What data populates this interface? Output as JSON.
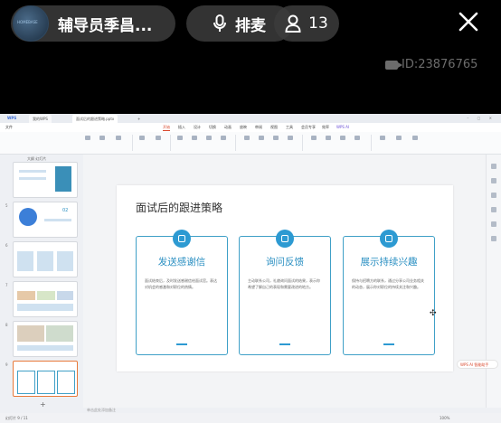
{
  "stream": {
    "host_name": "辅导员季昌...",
    "host_avatar_text": "HOMEBASE",
    "mic_label": "排麦",
    "viewer_count": "13",
    "stream_id": "ID:23876765",
    "icons": [
      "microphone-icon",
      "user-icon",
      "close-icon",
      "camera-icon"
    ]
  },
  "wps": {
    "app_logo": "WPS",
    "tabs": [
      "我的WPS",
      "面试后的跟进策略.pptx",
      "+"
    ],
    "menu": [
      "文件",
      "开始",
      "插入",
      "设计",
      "切换",
      "动画",
      "放映",
      "审阅",
      "视图",
      "工具",
      "会员专享",
      "效率",
      "WPS AI"
    ],
    "active_menu": "开始",
    "thumb_header": "大纲  幻灯片",
    "thumb_numbers": [
      "",
      "5",
      "6",
      "7",
      "8",
      "9"
    ],
    "thumb_5_number_text": "02",
    "notes_placeholder": "单击此处添加备注",
    "status_left": "幻灯片 9 / 11",
    "status_right": "100%",
    "wps_badge": "WPS AI 智能助手",
    "add_slide": "+"
  },
  "slide": {
    "title": "面试后的跟进策略",
    "cards": [
      {
        "heading": "发送感谢信",
        "body": "面试结束后，及时发送感谢信给面试官。表达对机会的感激和对职位的热情。"
      },
      {
        "heading": "询问反馈",
        "body": "主动联系公司，礼貌询问面试的结果，表示你希望了解自己的表现和需要改进的地方。"
      },
      {
        "heading": "展示持续兴趣",
        "body": "保持与招聘方的联系，通过分享公司业务相关的动态，展示你对职位的持续关注和兴趣。"
      }
    ]
  },
  "colors": {
    "accent": "#2d9ad2",
    "card_border": "#3fa0c7",
    "heading": "#2a8fc2",
    "selected_thumb": "#e8793a",
    "active_menu": "#d9472b"
  }
}
